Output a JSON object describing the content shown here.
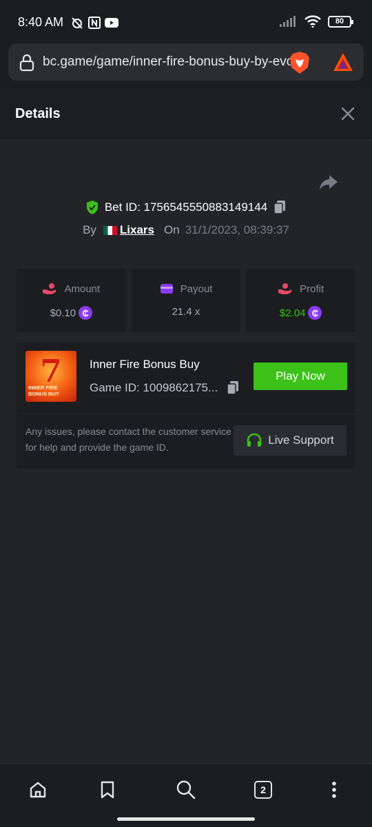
{
  "status_bar": {
    "time": "8:40 AM",
    "battery": "80",
    "icons": [
      "alarm-off-icon",
      "nfc-icon",
      "youtube-icon",
      "signal-icon",
      "wifi-icon",
      "battery-icon"
    ]
  },
  "browser": {
    "url": "bc.game/game/inner-fire-bonus-buy-by-evo"
  },
  "header": {
    "title": "Details"
  },
  "bet": {
    "id_label": "Bet ID: 1756545550883149144",
    "by_label": "By",
    "user": "Lixars",
    "on_label": "On",
    "date": "31/1/2023, 08:39:37"
  },
  "stats": [
    {
      "label": "Amount",
      "value": "$0.10",
      "icon": "hand-coins-icon",
      "color": "#e8476a"
    },
    {
      "label": "Payout",
      "value": "21.4 x",
      "icon": "wallet-icon",
      "color": "#8a3cf0"
    },
    {
      "label": "Profit",
      "value": "$2.04",
      "icon": "hand-heart-icon",
      "color": "#e8476a"
    }
  ],
  "game": {
    "name": "Inner Fire Bonus Buy",
    "id_label": "Game ID: 1009862175...",
    "play_label": "Play Now",
    "thumbnail_text": "INNER FIRE BONUS BUY",
    "thumbnail_number": "7",
    "issues_text": "Any issues, please contact the customer service for help and provide the game ID.",
    "support_label": "Live Support"
  },
  "coin_symbol": "₵",
  "nav": {
    "tab_count": "2"
  },
  "colors": {
    "accent_green": "#3bc117",
    "coin_purple": "#8a3cf0",
    "background": "#232428"
  }
}
